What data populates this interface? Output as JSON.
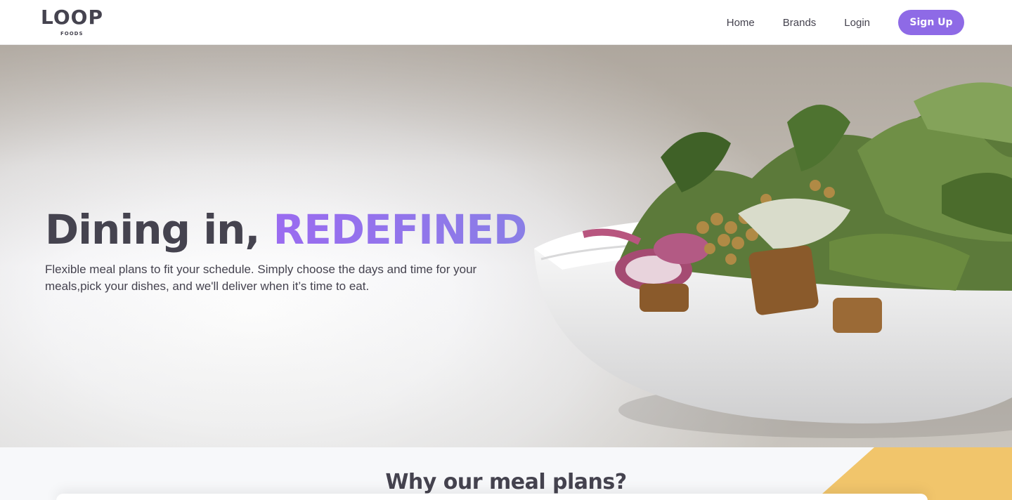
{
  "brand": {
    "name": "LOOP",
    "sub": "FOODS"
  },
  "nav": {
    "links": [
      "Home",
      "Brands",
      "Login"
    ],
    "signup": "Sign Up"
  },
  "hero": {
    "headline_main": "Dining in, ",
    "headline_accent": "REDEFINED",
    "subtext": "Flexible meal plans to fit your schedule. Simply choose the days and time for your meals,pick your dishes, and we'll deliver when it’s time to eat."
  },
  "section": {
    "title": "Why our meal plans?"
  },
  "colors": {
    "accent": "#8e6ae6",
    "text": "#45434f",
    "yellow": "#f1c56b"
  }
}
